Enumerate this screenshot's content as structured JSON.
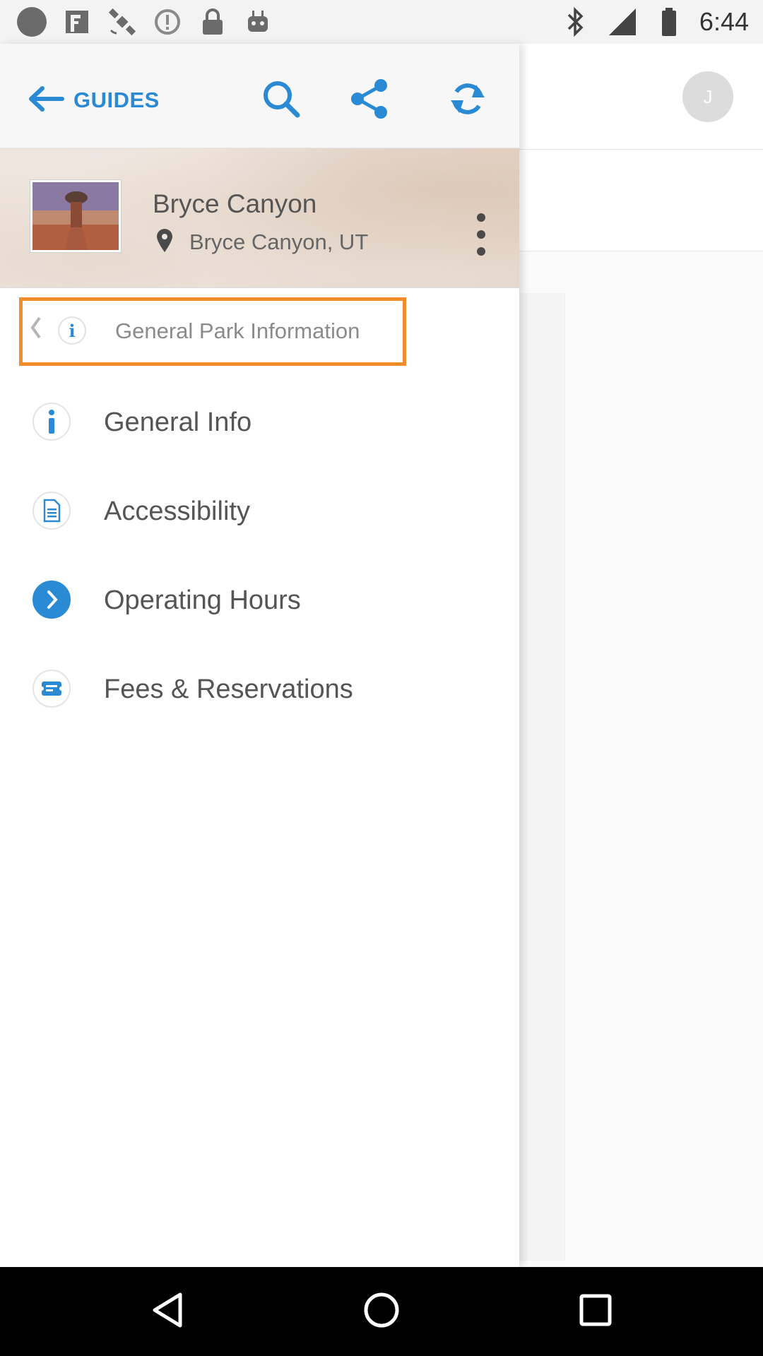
{
  "status_bar": {
    "time": "6:44",
    "left_icons": [
      "circle-icon",
      "fake-gps-icon",
      "satellite-icon",
      "alert-icon",
      "lock-icon",
      "android-icon"
    ],
    "right_icons": [
      "bluetooth-icon",
      "signal-icon",
      "battery-icon"
    ]
  },
  "background": {
    "avatar_initial": "J"
  },
  "drawer": {
    "back_label": "GUIDES",
    "header_icons": [
      "search-icon",
      "share-icon",
      "refresh-icon"
    ],
    "park": {
      "title": "Bryce Canyon",
      "location": "Bryce Canyon, UT"
    },
    "section_header": "General Park Information",
    "menu_items": [
      {
        "label": "General Info",
        "icon": "info-icon"
      },
      {
        "label": "Accessibility",
        "icon": "document-icon"
      },
      {
        "label": "Operating Hours",
        "icon": "chevron-right-icon"
      },
      {
        "label": "Fees & Reservations",
        "icon": "ticket-icon"
      }
    ]
  },
  "colors": {
    "accent": "#2a8ad4",
    "highlight_border": "#f28c2b"
  },
  "nav_bar": {
    "buttons": [
      "back-icon",
      "home-icon",
      "recents-icon"
    ]
  }
}
